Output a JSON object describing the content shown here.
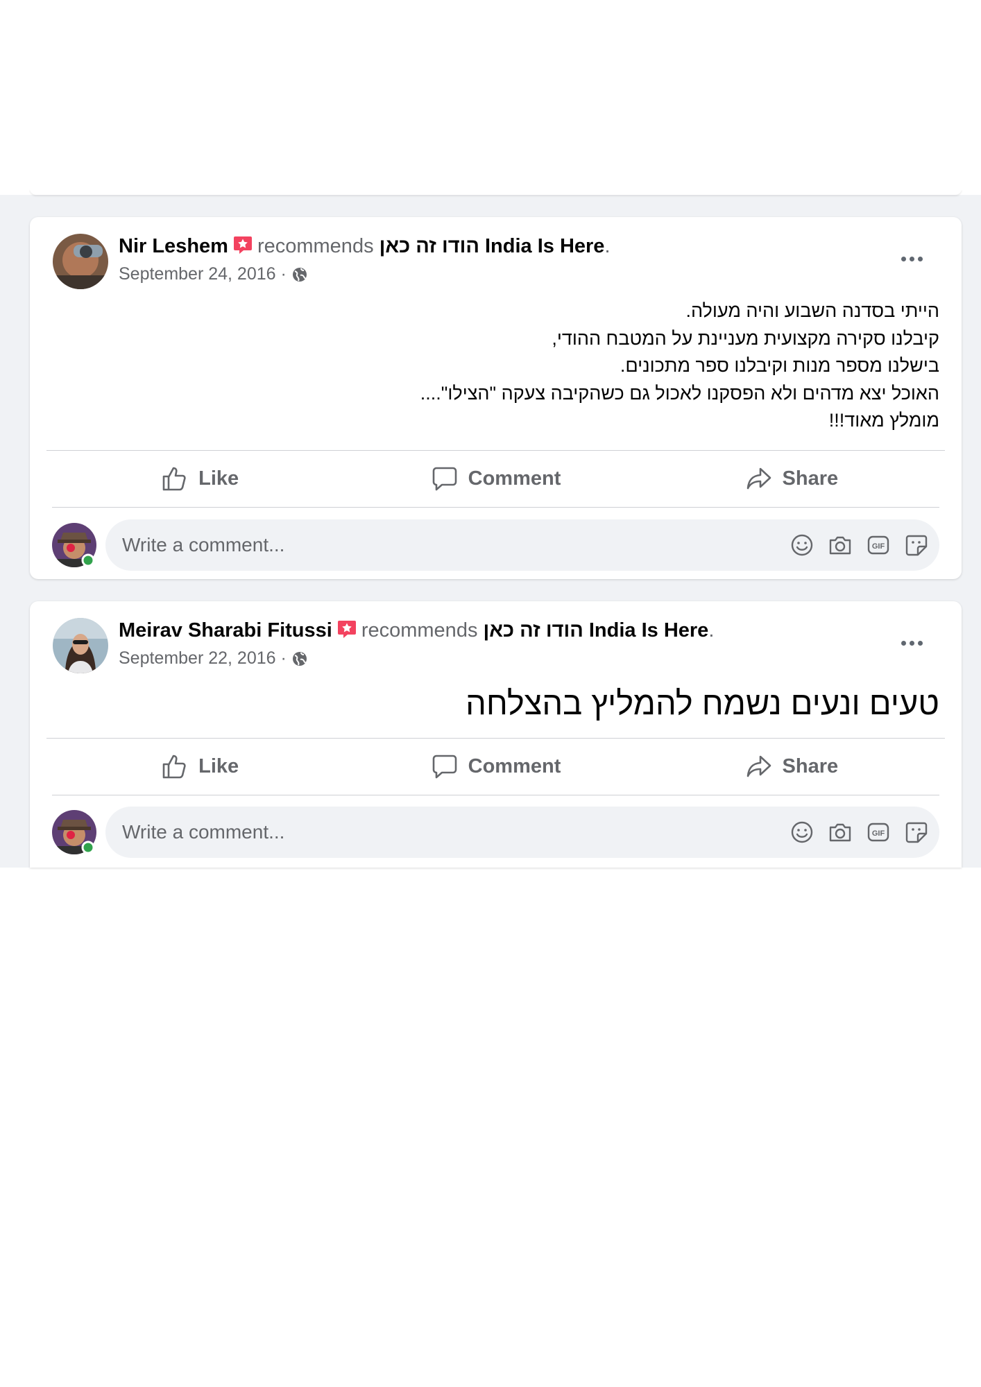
{
  "posts": [
    {
      "author": "Nir Leshem",
      "verb": "recommends",
      "page": "הודו זה כאן India Is Here",
      "period": ".",
      "date": "September 24, 2016",
      "date_sep": " · ",
      "body_lines": [
        "הייתי בסדנה השבוע והיה מעולה.",
        "קיבלנו סקירה מקצועית מעניינת על המטבח ההודי,",
        "בישלנו מספר מנות וקיבלנו ספר מתכונים.",
        "האוכל יצא מדהים ולא הפסקנו לאכול גם כשהקיבה צעקה \"הצילו\"....",
        "מומלץ מאוד!!!"
      ],
      "actions": {
        "like": "Like",
        "comment": "Comment",
        "share": "Share"
      },
      "comment_placeholder": "Write a comment..."
    },
    {
      "author": "Meirav Sharabi Fitussi",
      "verb": "recommends",
      "page": "הודו זה כאן India Is Here",
      "period": ".",
      "date": "September 22, 2016",
      "date_sep": " · ",
      "body_lines": [
        "טעים ונעים נשמח להמליץ בהצלחה"
      ],
      "actions": {
        "like": "Like",
        "comment": "Comment",
        "share": "Share"
      },
      "comment_placeholder": "Write a comment..."
    }
  ],
  "icons": {
    "recommend_badge": "star-badge-icon",
    "privacy": "globe-icon",
    "more": "more-options-icon",
    "like": "thumbs-up-icon",
    "comment": "speech-bubble-icon",
    "share": "share-arrow-icon",
    "emoji": "smiley-icon",
    "photo": "camera-icon",
    "gif": "gif-icon",
    "sticker": "sticker-icon"
  },
  "colors": {
    "background": "#f0f2f5",
    "card": "#ffffff",
    "text_primary": "#050505",
    "text_secondary": "#65676b",
    "badge": "#f3425f",
    "online": "#31a24c"
  }
}
